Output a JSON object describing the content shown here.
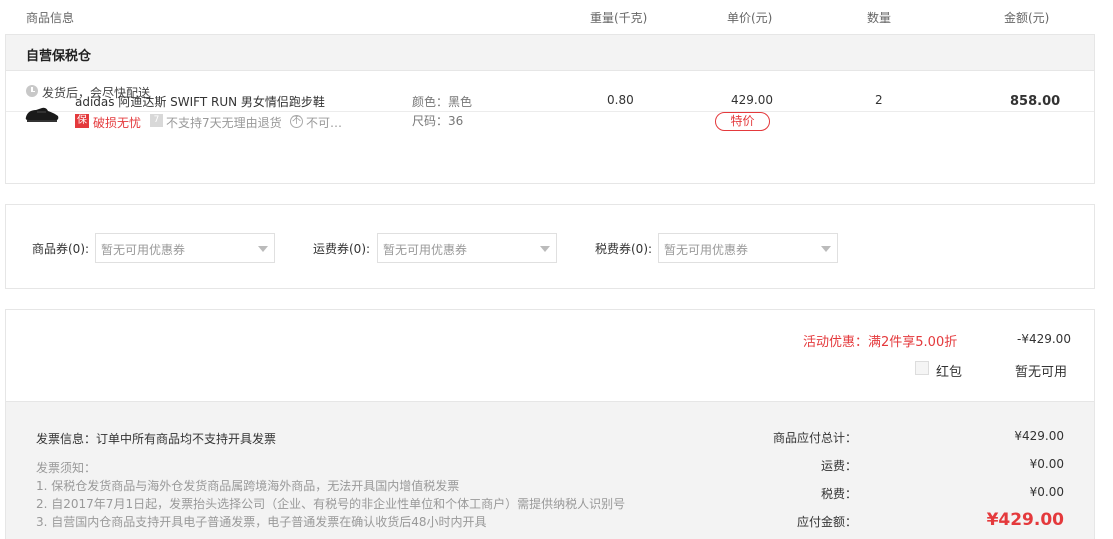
{
  "header": {
    "product_info": "商品信息",
    "weight": "重量(千克)",
    "unit_price": "单价(元)",
    "quantity": "数量",
    "amount": "金额(元)"
  },
  "warehouse": {
    "title": "自营保税仓",
    "shipping_note": "发货后，会尽快配送"
  },
  "item": {
    "image": "shoe-image",
    "name": "adidas 阿迪达斯 SWIFT RUN 男女情侣跑步鞋",
    "tag1_icon": "保",
    "tag1": "破损无忧",
    "tag2_icon": "7",
    "tag2": "不支持7天无理由退货",
    "tag3_icon": "不",
    "tag3": "不可…",
    "color_label": "颜色：",
    "color": "黑色",
    "size_label": "尺码：",
    "size": "36",
    "weight": "0.80",
    "unit_price": "429.00",
    "special_badge": "特价",
    "quantity": "2",
    "amount": "858.00"
  },
  "coupons": [
    {
      "label": "商品券(0):",
      "placeholder": "暂无可用优惠券"
    },
    {
      "label": "运费券(0):",
      "placeholder": "暂无可用优惠券"
    },
    {
      "label": "税费券(0):",
      "placeholder": "暂无可用优惠券"
    }
  ],
  "summary": {
    "promo_label": "活动优惠：满2件享5.00折",
    "promo_value": "-¥429.00",
    "red_packet_label": "红包",
    "red_packet_value": "暂无可用",
    "invoice_info": "发票信息：订单中所有商品均不支持开具发票",
    "invoice_notice_title": "发票须知：",
    "invoice_notes": [
      "1. 保税仓发货商品与海外仓发货商品属跨境海外商品，无法开具国内增值税发票",
      "2. 自2017年7月1日起，发票抬头选择公司（企业、有税号的非企业性单位和个体工商户）需提供纳税人识别号",
      "3. 自营国内仓商品支持开具电子普通发票，电子普通发票在确认收货后48小时内开具"
    ],
    "goods_total_label": "商品应付总计：",
    "goods_total": "¥429.00",
    "shipping_label": "运费：",
    "shipping": "¥0.00",
    "tax_label": "税费：",
    "tax": "¥0.00",
    "payable_label": "应付金额：",
    "payable": "¥429.00"
  }
}
